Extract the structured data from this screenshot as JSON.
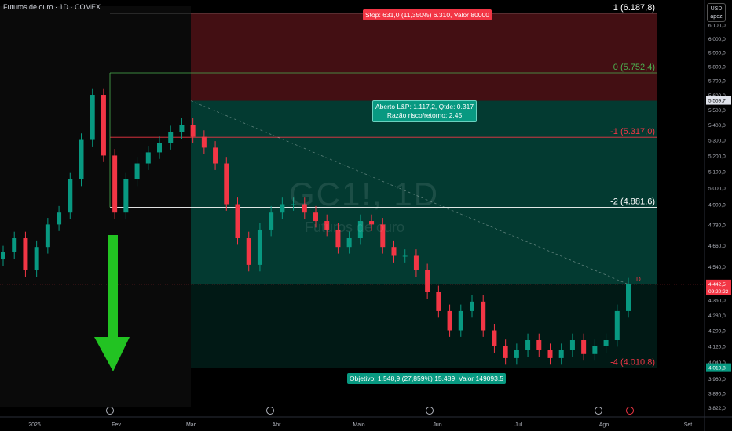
{
  "header": {
    "symbol_title": "Futuros de ouro · 1D · COMEX",
    "currency": "USD",
    "currency_sub": "apoz"
  },
  "watermark": {
    "ticker": "GC1!, 1D",
    "name": "Futuros de ouro"
  },
  "position": {
    "stop_label": "Stop: 631,0 (11,350%) 6.310, Valor 80000",
    "open_label_1": "Aberto L&P: 1.117,2, Qtde: 0.317",
    "open_label_2": "Razão risco/retorno: 2,45",
    "target_label": "Objetivo: 1.548,9 (27,859%) 15.489, Valor 149093.5",
    "entry": 5559.7,
    "stop": 6187.8,
    "target": 4010.8
  },
  "fib_levels": [
    {
      "label": "1 (6.187,8)",
      "value": 6187.8,
      "color": "white"
    },
    {
      "label": "0 (5.752,4)",
      "value": 5752.4,
      "color": "green"
    },
    {
      "label": "-1 (5.317,0)",
      "value": 5317.0,
      "color": "red"
    },
    {
      "label": "-2 (4.881,6)",
      "value": 4881.6,
      "color": "white"
    },
    {
      "label": "-4 (4.010,8)",
      "value": 4010.8,
      "color": "red"
    }
  ],
  "price_tags": {
    "entry_tag": "5.559,7",
    "current_tag": "4.442,5",
    "current_time": "09:20:22",
    "target_tag": "4.010,8",
    "marker": "D"
  },
  "colors": {
    "up": "#089981",
    "down": "#f23645",
    "accent_green": "#22c322",
    "background": "#000000"
  },
  "chart_data": {
    "type": "candlestick",
    "title": "Futuros de ouro · 1D · COMEX",
    "x_ticks": [
      "2026",
      "Fev",
      "Mar",
      "Abr",
      "Maio",
      "Jun",
      "Jul",
      "Ago",
      "Set"
    ],
    "y_ticks": [
      "6.100,0",
      "6.000,0",
      "5.900,0",
      "5.800,0",
      "5.700,0",
      "5.600,0",
      "5.500,0",
      "5.400,0",
      "5.300,0",
      "5.200,0",
      "5.100,0",
      "5.000,0",
      "4.900,0",
      "4.780,0",
      "4.660,0",
      "4.540,0",
      "4.440,0",
      "4.360,0",
      "4.280,0",
      "4.200,0",
      "4.120,0",
      "4.040,0",
      "3.960,0",
      "3.890,0",
      "3.822,0"
    ],
    "ylim": [
      3822,
      6240
    ],
    "y_scale": "log",
    "grid": false,
    "series_close_by_week": [
      4620,
      4700,
      4520,
      4650,
      4780,
      4850,
      5050,
      5300,
      5600,
      5200,
      4850,
      5050,
      5150,
      5220,
      5280,
      5350,
      5400,
      5320,
      5250,
      5150,
      4900,
      4700,
      4550,
      4750,
      4850,
      4900,
      4900,
      4850,
      4800,
      4750,
      4650,
      4700,
      4800,
      4780,
      4650,
      4600,
      4600,
      4520,
      4400,
      4300,
      4200,
      4300,
      4350,
      4200,
      4120,
      4060,
      4100,
      4150,
      4100,
      4060,
      4100,
      4150,
      4080,
      4120,
      4150,
      4300,
      4442
    ]
  }
}
